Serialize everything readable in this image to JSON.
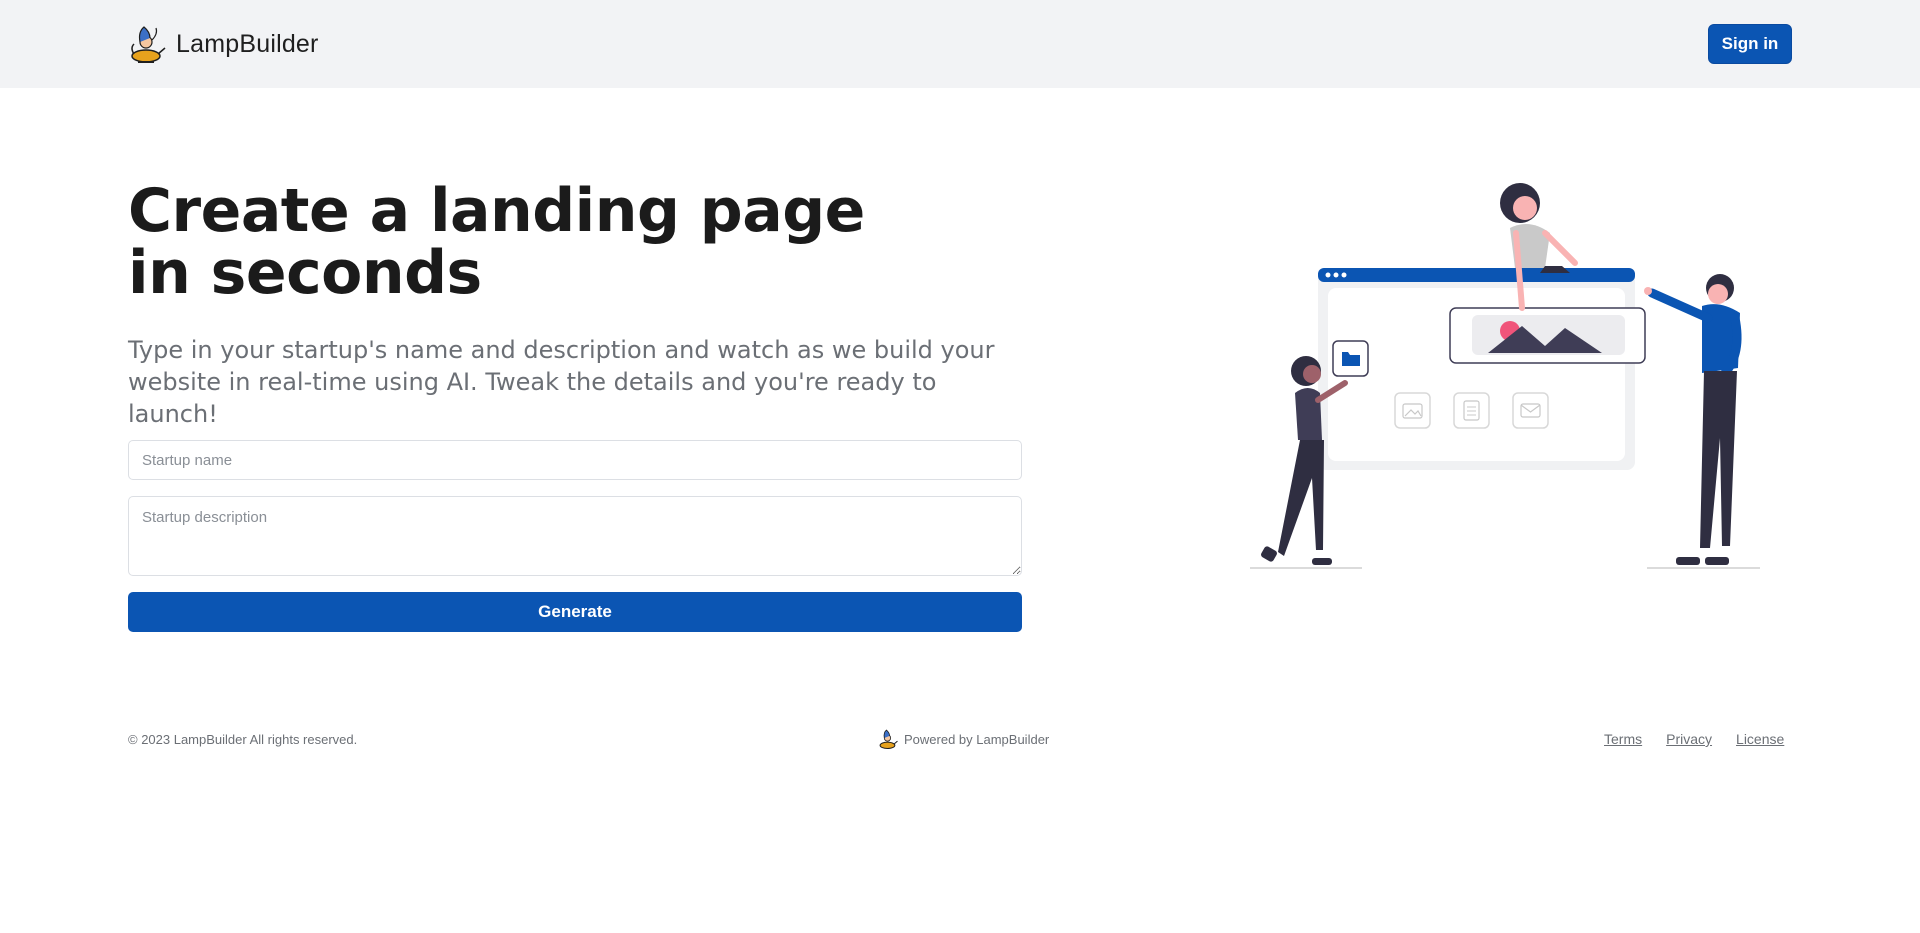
{
  "header": {
    "brand_name": "LampBuilder",
    "logo_icon": "lamp-genie-icon",
    "signin_label": "Sign in"
  },
  "hero": {
    "title": "Create a landing page in seconds",
    "subtitle": "Type in your startup's name and description and watch as we build your website in real-time using AI. Tweak the details and you're ready to launch!"
  },
  "form": {
    "name_placeholder": "Startup name",
    "name_value": "",
    "description_placeholder": "Startup description",
    "description_value": "",
    "generate_label": "Generate"
  },
  "illustration": {
    "subject": "people-building-website-illustration",
    "accent_color": "#0b55b3"
  },
  "footer": {
    "copyright": "© 2023 LampBuilder All rights reserved.",
    "powered_by": "Powered by LampBuilder",
    "links": [
      {
        "label": "Terms"
      },
      {
        "label": "Privacy"
      },
      {
        "label": "License"
      }
    ]
  },
  "colors": {
    "primary": "#0b55b3",
    "header_bg": "#f2f3f5",
    "muted_text": "#6b6f75"
  }
}
